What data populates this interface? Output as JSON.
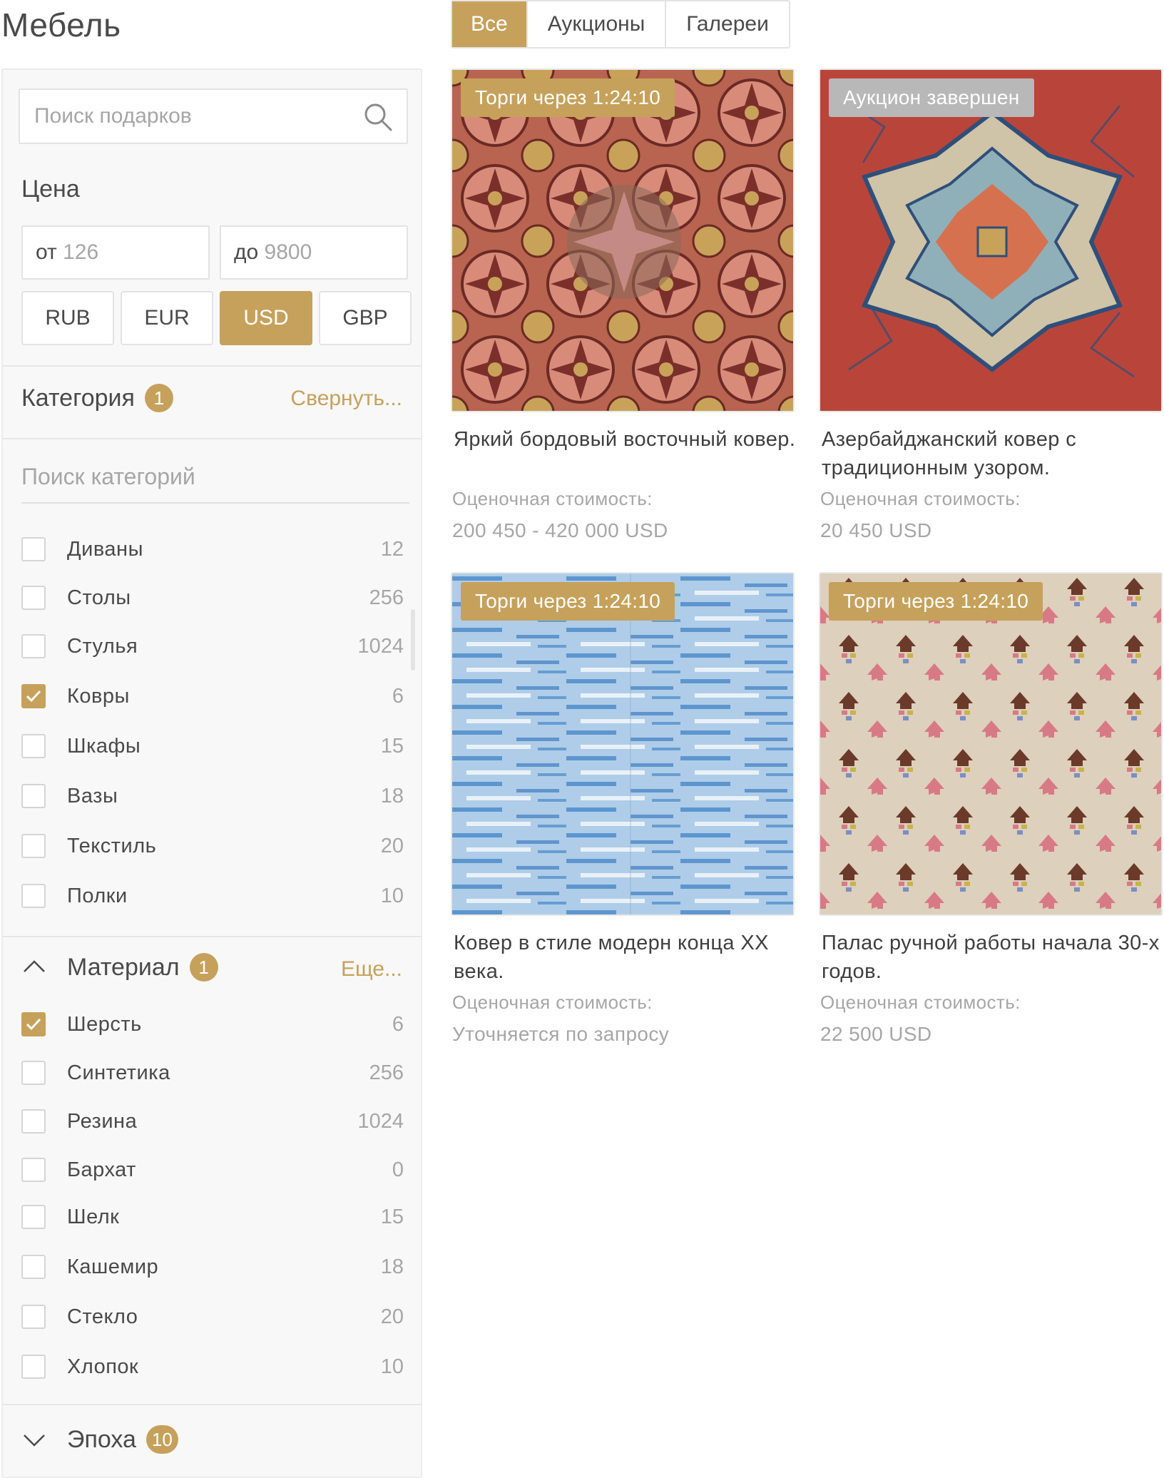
{
  "page": {
    "title": "Мебель"
  },
  "tabs": [
    {
      "label": "Все",
      "active": true
    },
    {
      "label": "Аукционы",
      "active": false
    },
    {
      "label": "Галереи",
      "active": false
    }
  ],
  "sidebar": {
    "search": {
      "placeholder": "Поиск подарков"
    },
    "price": {
      "label": "Цена",
      "from_prefix": "от",
      "from_value": "126",
      "to_prefix": "до",
      "to_value": "9800"
    },
    "currencies": [
      {
        "label": "RUB",
        "active": false
      },
      {
        "label": "EUR",
        "active": false
      },
      {
        "label": "USD",
        "active": true
      },
      {
        "label": "GBP",
        "active": false
      }
    ],
    "category": {
      "label": "Категория",
      "badge": "1",
      "link": "Свернуть...",
      "search_placeholder": "Поиск категорий",
      "items": [
        {
          "label": "Диваны",
          "count": "12",
          "checked": false
        },
        {
          "label": "Столы",
          "count": "256",
          "checked": false
        },
        {
          "label": "Стулья",
          "count": "1024",
          "checked": false
        },
        {
          "label": "Ковры",
          "count": "6",
          "checked": true
        },
        {
          "label": "Шкафы",
          "count": "15",
          "checked": false
        },
        {
          "label": "Вазы",
          "count": "18",
          "checked": false
        },
        {
          "label": "Текстиль",
          "count": "20",
          "checked": false
        },
        {
          "label": "Полки",
          "count": "10",
          "checked": false
        }
      ]
    },
    "material": {
      "label": "Материал",
      "badge": "1",
      "link": "Еще...",
      "expanded": true,
      "items": [
        {
          "label": "Шерсть",
          "count": "6",
          "checked": true
        },
        {
          "label": "Синтетика",
          "count": "256",
          "checked": false
        },
        {
          "label": "Резина",
          "count": "1024",
          "checked": false
        },
        {
          "label": "Бархат",
          "count": "0",
          "checked": false
        },
        {
          "label": "Шелк",
          "count": "15",
          "checked": false
        },
        {
          "label": "Кашемир",
          "count": "18",
          "checked": false
        },
        {
          "label": "Стекло",
          "count": "20",
          "checked": false
        },
        {
          "label": "Хлопок",
          "count": "10",
          "checked": false
        }
      ]
    },
    "era": {
      "label": "Эпоха",
      "badge": "10",
      "expanded": false
    }
  },
  "products": [
    {
      "status": "Торги через 1:24:10",
      "status_type": "live",
      "title": "Яркий бордовый восточный ковер.",
      "estimate_label": "Оценочная стоимость:",
      "estimate_value": "200 450 - 420 000 USD"
    },
    {
      "status": "Аукцион завершен",
      "status_type": "ended",
      "title": "Азербайджанский ковер с традиционным узором.",
      "estimate_label": "Оценочная стоимость:",
      "estimate_value": "20 450 USD"
    },
    {
      "status": "Торги через 1:24:10",
      "status_type": "live",
      "title": "Ковер в стиле модерн конца XX века.",
      "estimate_label": "Оценочная стоимость:",
      "estimate_value": "Уточняется по запросу"
    },
    {
      "status": "Торги через 1:24:10",
      "status_type": "live",
      "title": "Палас ручной работы начала 30-х годов.",
      "estimate_label": "Оценочная стоимость:",
      "estimate_value": "22 500 USD"
    }
  ],
  "colors": {
    "accent": "#c6a15b",
    "badge_ended": "#b8b8b8",
    "text": "#3f3f3f",
    "muted": "#a6a6a6"
  }
}
